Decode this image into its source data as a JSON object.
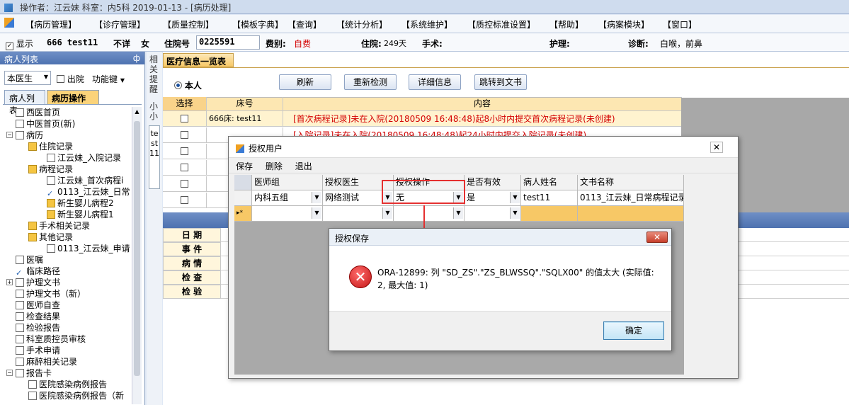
{
  "window": {
    "title": "操作者：江云妹   科室：内5科   2019-01-13 - [病历处理]"
  },
  "menu": [
    "【病历管理】",
    "【诊疗管理】",
    "【质量控制】",
    "【模板字典】",
    "【查询】",
    "【统计分析】",
    "【系统维护】",
    "【质控标准设置】",
    "【帮助】",
    "【病案模块】",
    "【窗口】"
  ],
  "patient": {
    "show_label": "显示",
    "name": "666 test11",
    "unknown": "不详",
    "sex": "女",
    "inpatient_no_label": "住院号",
    "inpatient_no": "0225591",
    "fee_label": "费别:",
    "fee_value": "自费",
    "stay_label": "住院:",
    "stay_value": "249天",
    "surgery_label": "手术:",
    "nursing_label": "护理:",
    "diagnosis_label": "诊断:",
    "diagnosis_value": "白喉，前鼻"
  },
  "left_panel": {
    "title": "病人列表",
    "pin": "ф",
    "doctor_filter": "本医生",
    "discharged_label": "出院",
    "function_label": "功能键",
    "tabs": [
      "病人列表",
      "病历操作"
    ],
    "tree": [
      {
        "label": "西医首页",
        "indent": 1,
        "icon": "doc"
      },
      {
        "label": "中医首页(新)",
        "indent": 1,
        "icon": "doc"
      },
      {
        "label": "病历",
        "indent": 1,
        "icon": "doc"
      },
      {
        "label": "住院记录",
        "indent": 2,
        "icon": "folder"
      },
      {
        "label": "江云妹_入院记录",
        "indent": 3,
        "icon": "doc"
      },
      {
        "label": "病程记录",
        "indent": 2,
        "icon": "folder"
      },
      {
        "label": "江云妹_首次病程i",
        "indent": 3,
        "icon": "doc"
      },
      {
        "label": "0113_江云妹_日常",
        "indent": 3,
        "icon": "check"
      },
      {
        "label": "新生婴儿病程2",
        "indent": 3,
        "icon": "folder"
      },
      {
        "label": "新生婴儿病程1",
        "indent": 3,
        "icon": "folder"
      },
      {
        "label": "手术相关记录",
        "indent": 2,
        "icon": "folder"
      },
      {
        "label": "其他记录",
        "indent": 2,
        "icon": "folder"
      },
      {
        "label": "0113_江云妹_申请",
        "indent": 3,
        "icon": "doc"
      },
      {
        "label": "医嘱",
        "indent": 1,
        "icon": "doc"
      },
      {
        "label": "临床路径",
        "indent": 1,
        "icon": "check"
      },
      {
        "label": "护理文书",
        "indent": 1,
        "icon": "doc"
      },
      {
        "label": "护理文书（新）",
        "indent": 1,
        "icon": "doc"
      },
      {
        "label": "医师自查",
        "indent": 1,
        "icon": "doc"
      },
      {
        "label": "检查结果",
        "indent": 1,
        "icon": "doc"
      },
      {
        "label": "检验报告",
        "indent": 1,
        "icon": "doc"
      },
      {
        "label": "科室质控员审核",
        "indent": 1,
        "icon": "doc"
      },
      {
        "label": "手术申请",
        "indent": 1,
        "icon": "doc"
      },
      {
        "label": "麻醉相关记录",
        "indent": 1,
        "icon": "doc"
      },
      {
        "label": "报告卡",
        "indent": 1,
        "icon": "doc"
      },
      {
        "label": "医院感染病例报告",
        "indent": 2,
        "icon": "doc"
      },
      {
        "label": "医院感染病例报告（新",
        "indent": 2,
        "icon": "doc"
      }
    ]
  },
  "side_tab": {
    "chars1": "相关提醒",
    "chars2": "小小",
    "chars3": "test11"
  },
  "main": {
    "tab_title": "医疗信息一览表",
    "radio_label": "本人",
    "buttons": [
      "刷新",
      "重新检测",
      "详细信息",
      "跳转到文书"
    ],
    "grid_headers": [
      "选择",
      "床号",
      "内容"
    ],
    "rows": [
      {
        "bed": "666床: test11",
        "content": "[首次病程记录]未在入院(20180509  16:48:48)起8小时内提交首次病程记录(未创建)"
      },
      {
        "bed": "",
        "content": "[入院记录]未在入院(20180509  16:48:48)起24小时内提交入院记录(未创建)"
      },
      {
        "bed": "",
        "content": ""
      },
      {
        "bed": "",
        "content": ""
      },
      {
        "bed": "",
        "content": ""
      },
      {
        "bed": "",
        "content": ""
      }
    ],
    "timeline_rows": [
      "日  期",
      "事  件",
      "病  情",
      "检  查",
      "检  验"
    ]
  },
  "auth_dialog": {
    "title": "授权用户",
    "toolbar": [
      "保存",
      "删除",
      "退出"
    ],
    "headers": [
      "医师组",
      "授权医生",
      "授权操作",
      "是否有效",
      "病人姓名",
      "文书名称"
    ],
    "row": {
      "group": "内科五组",
      "doctor": "网络测试",
      "operation": "无",
      "valid": "是",
      "patient": "test11",
      "document": "0113_江云妹_日常病程记录"
    }
  },
  "error_dialog": {
    "title": "授权保存",
    "message_line1": "ORA-12899: 列 \"SD_ZS\".\"ZS_BLWSSQ\".\"SQLX00\" 的值太大 (实际值:",
    "message_line2": "2, 最大值: 1)",
    "ok_label": "确定"
  },
  "colors": {
    "accent_red": "#e53030",
    "warning_text": "#d40000",
    "header_bg": "#fde7b2"
  }
}
